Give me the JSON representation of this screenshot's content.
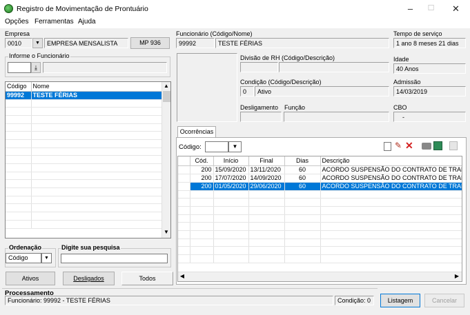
{
  "window": {
    "title": "Registro de Movimentação de Prontuário",
    "minimize": "–",
    "maximize": "☐",
    "close": "✕"
  },
  "menu": [
    "Opções",
    "Ferramentas",
    "Ajuda"
  ],
  "empresa": {
    "label": "Empresa",
    "code": "0010",
    "name": "EMPRESA MENSALISTA",
    "mp_button": "MP 936"
  },
  "informe": {
    "label": "Informe o Funcionário",
    "value": ""
  },
  "emp_list": {
    "headers": [
      "Código",
      "Nome"
    ],
    "rows": [
      {
        "codigo": "99992",
        "nome": "TESTE FÉRIAS"
      }
    ]
  },
  "ordenacao": {
    "label": "Ordenação",
    "value": "Código"
  },
  "pesquisa": {
    "label": "Digite sua pesquisa",
    "value": ""
  },
  "filter_buttons": {
    "ativos": "Ativos",
    "desligados": "Desligados",
    "todos": "Todos"
  },
  "funcionario": {
    "label": "Funcionário (Código/Nome)",
    "code": "99992",
    "name": "TESTE FÉRIAS"
  },
  "tempo_servico": {
    "label": "Tempo de serviço",
    "value": "1 ano 8 meses 21 dias"
  },
  "divisao": {
    "label": "Divisão de RH (Código/Descrição)",
    "code": "",
    "desc": ""
  },
  "idade": {
    "label": "Idade",
    "value": "40 Anos"
  },
  "condicao": {
    "label": "Condição (Código/Descrição)",
    "code": "0",
    "desc": "Ativo"
  },
  "admissao": {
    "label": "Admissão",
    "value": "14/03/2019"
  },
  "desligamento": {
    "label": "Desligamento",
    "value": ""
  },
  "funcao": {
    "label": "Função",
    "value": ""
  },
  "cbo": {
    "label": "CBO",
    "value": "-"
  },
  "ocorrencias": {
    "tab": "Ocorrências",
    "codigo_label": "Código:",
    "codigo_value": "",
    "headers": [
      "Cód.",
      "Início",
      "Final",
      "Dias",
      "Descrição"
    ],
    "rows": [
      {
        "cod": "200",
        "inicio": "15/09/2020",
        "final": "13/11/2020",
        "dias": "60",
        "descricao": "ACORDO SUSPENSÃO DO CONTRATO DE TRABALHO",
        "selected": false
      },
      {
        "cod": "200",
        "inicio": "17/07/2020",
        "final": "14/09/2020",
        "dias": "60",
        "descricao": "ACORDO SUSPENSÃO DO CONTRATO DE TRABALHO",
        "selected": false
      },
      {
        "cod": "200",
        "inicio": "01/05/2020",
        "final": "29/06/2020",
        "dias": "60",
        "descricao": "ACORDO SUSPENSÃO DO CONTRATO DE TRABALHO",
        "selected": true
      }
    ]
  },
  "processamento": {
    "label": "Processamento",
    "text": "Funcionário: 99992 - TESTE FÉRIAS",
    "condicao": "Condição: 0"
  },
  "actions": {
    "listagem": "Listagem",
    "cancelar": "Cancelar"
  },
  "colors": {
    "selection": "#0078d7",
    "window_bg": "#f0f0f0",
    "delete_icon": "#d42020"
  }
}
